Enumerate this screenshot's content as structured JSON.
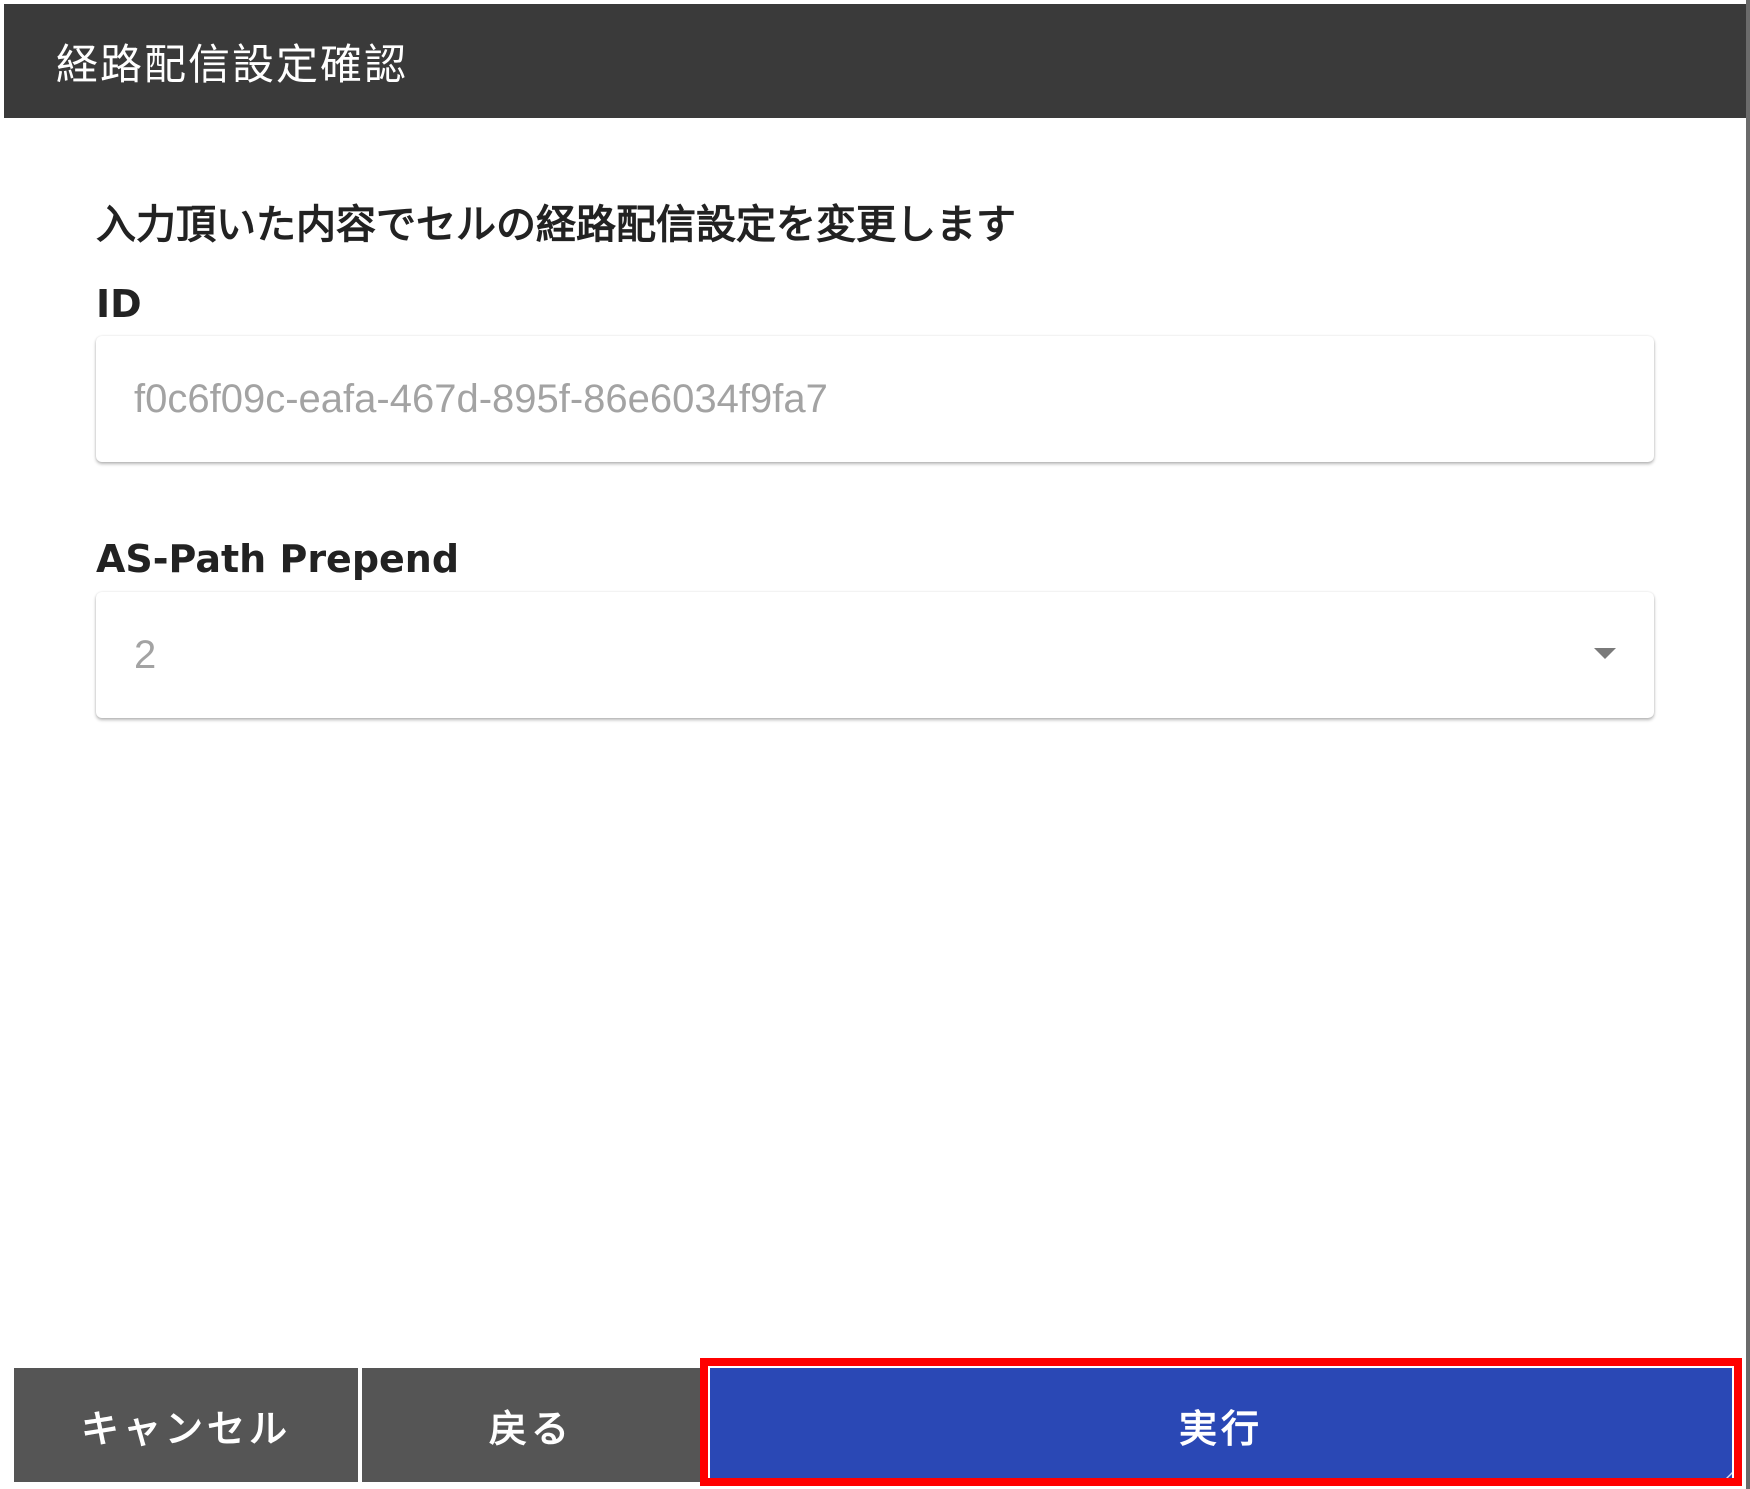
{
  "dialog": {
    "title": "経路配信設定確認",
    "description": "入力頂いた内容でセルの経路配信設定を変更します"
  },
  "fields": {
    "id": {
      "label": "ID",
      "value": "f0c6f09c-eafa-467d-895f-86e6034f9fa7"
    },
    "as_path_prepend": {
      "label": "AS-Path Prepend",
      "selected": "2"
    }
  },
  "buttons": {
    "cancel_label": "キャンセル",
    "back_label": "戻る",
    "execute_label": "実行"
  },
  "colors": {
    "header_bg": "#3a3a3a",
    "secondary_button": "#555555",
    "primary_button": "#2a48b5",
    "highlight_border": "#ff0000"
  },
  "icons": {
    "select_caret": "caret-down-icon"
  }
}
